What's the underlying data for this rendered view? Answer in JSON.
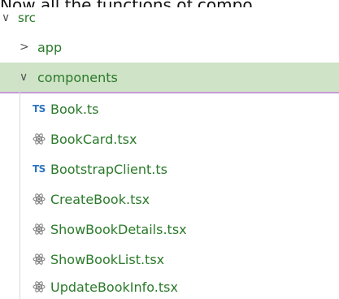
{
  "caption": "Now all the functions of compo",
  "tree": {
    "root": {
      "label": "src",
      "expanded": true
    },
    "folders": [
      {
        "label": "app",
        "expanded": false,
        "selected": false
      },
      {
        "label": "components",
        "expanded": true,
        "selected": true
      }
    ],
    "files": [
      {
        "label": "Book.ts",
        "icon": "ts-icon",
        "icon_text": "TS"
      },
      {
        "label": "BookCard.tsx",
        "icon": "react-icon"
      },
      {
        "label": "BootstrapClient.ts",
        "icon": "ts-icon",
        "icon_text": "TS"
      },
      {
        "label": "CreateBook.tsx",
        "icon": "react-icon"
      },
      {
        "label": "ShowBookDetails.tsx",
        "icon": "react-icon"
      },
      {
        "label": "ShowBookList.tsx",
        "icon": "react-icon"
      },
      {
        "label": "UpdateBookInfo.tsx",
        "icon": "react-icon"
      }
    ],
    "colors": {
      "file_text": "#2a7a2a",
      "ts_icon": "#2f74c0",
      "selection_bg": "#cfe3c7",
      "selection_border": "#c79ad6"
    }
  }
}
